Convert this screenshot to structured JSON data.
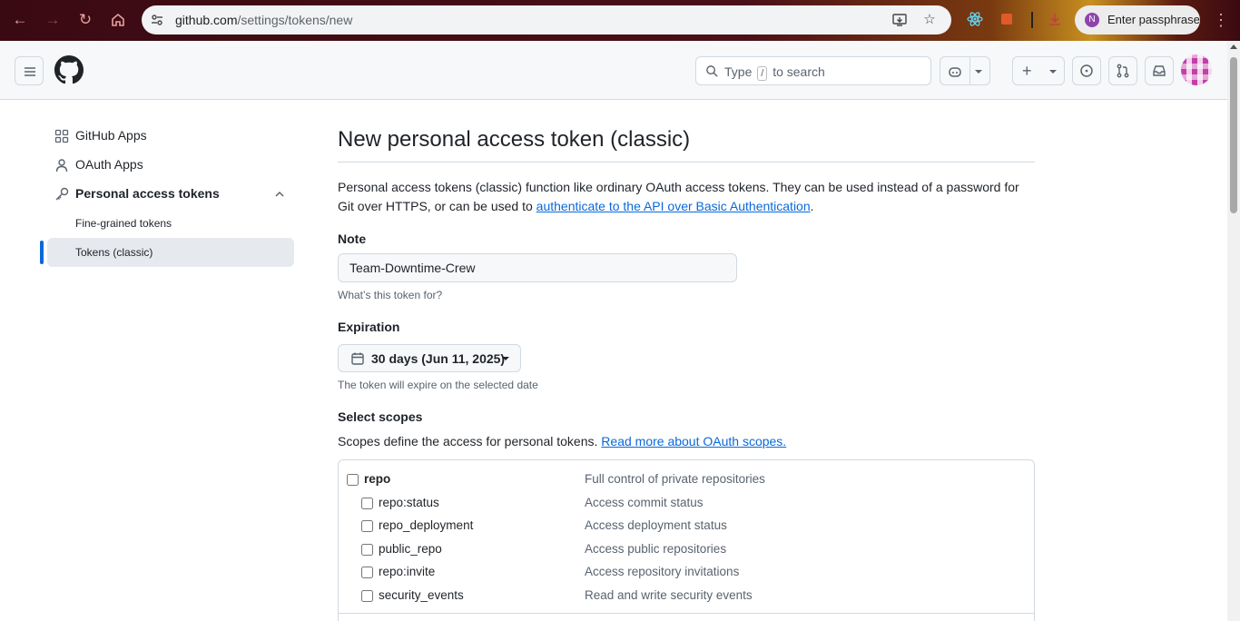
{
  "browser": {
    "url_host": "github.com",
    "url_path": "/settings/tokens/new",
    "profile_label": "Enter passphrase",
    "profile_initial": "N"
  },
  "header": {
    "search_placeholder_pre": "Type",
    "search_key": "/",
    "search_placeholder_post": "to search"
  },
  "sidebar": {
    "items": [
      {
        "label": "GitHub Apps",
        "icon": "apps-grid-icon"
      },
      {
        "label": "OAuth Apps",
        "icon": "person-icon"
      },
      {
        "label": "Personal access tokens",
        "icon": "key-icon"
      }
    ],
    "sub_items": [
      {
        "label": "Fine-grained tokens"
      },
      {
        "label": "Tokens (classic)"
      }
    ]
  },
  "main": {
    "title": "New personal access token (classic)",
    "intro_text": "Personal access tokens (classic) function like ordinary OAuth access tokens. They can be used instead of a password for Git over HTTPS, or can be used to ",
    "intro_link": "authenticate to the API over Basic Authentication",
    "intro_end": ".",
    "note_label": "Note",
    "note_value": "Team-Downtime-Crew",
    "note_hint": "What’s this token for?",
    "expiration_label": "Expiration",
    "expiration_value": "30 days (Jun 11, 2025)",
    "expiration_hint": "The token will expire on the selected date",
    "scopes_label": "Select scopes",
    "scopes_desc": "Scopes define the access for personal tokens.",
    "scopes_link": "Read more about OAuth scopes.",
    "scopes": [
      {
        "name": "repo",
        "desc": "Full control of private repositories",
        "child": false
      },
      {
        "name": "repo:status",
        "desc": "Access commit status",
        "child": true
      },
      {
        "name": "repo_deployment",
        "desc": "Access deployment status",
        "child": true
      },
      {
        "name": "public_repo",
        "desc": "Access public repositories",
        "child": true
      },
      {
        "name": "repo:invite",
        "desc": "Access repository invitations",
        "child": true
      },
      {
        "name": "security_events",
        "desc": "Read and write security events",
        "child": true
      }
    ]
  },
  "colors": {
    "accent": "#0969da",
    "link": "#0969da"
  }
}
